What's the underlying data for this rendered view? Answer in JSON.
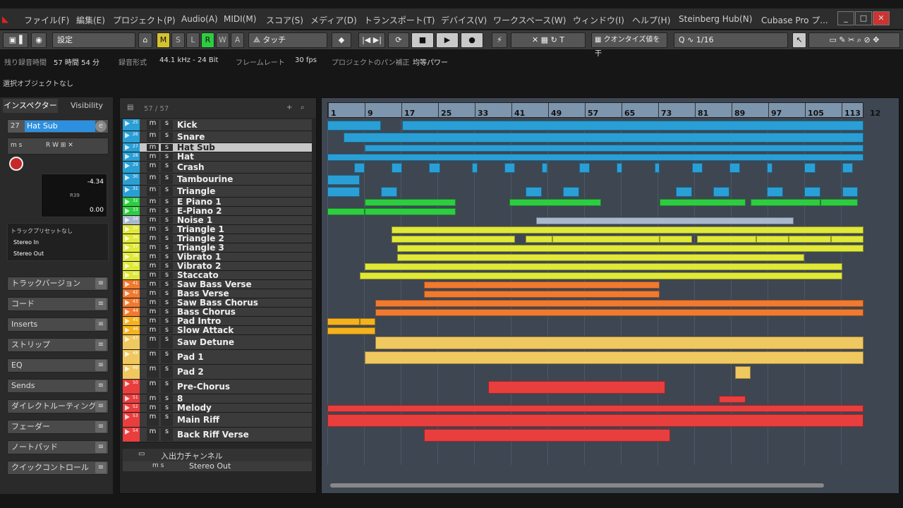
{
  "menu": [
    "ファイル(F)",
    "編集(E)",
    "プロジェクト(P)",
    "Audio(A)",
    "MIDI(M)",
    "スコア(S)",
    "メディア(D)",
    "トランスポート(T)",
    "デバイス(V)",
    "ワークスペース(W)",
    "ウィンドウ(I)",
    "ヘルプ(H)",
    "Steinberg Hub(N)",
    "Cubase Pro プ..."
  ],
  "toolbar": {
    "preset": "設定",
    "modes": [
      "M",
      "S",
      "L",
      "R",
      "W",
      "A"
    ],
    "touch": "タッチ",
    "quantize_label": "クオンタイズ値を干",
    "quantize_value": "1/16"
  },
  "status": {
    "rec_time_label": "残り録音時間",
    "rec_time": "57 時間 54 分",
    "rec_format_label": "録音形式",
    "rec_format": "44.1 kHz - 24 Bit",
    "frame_label": "フレームレート",
    "frame": "30 fps",
    "pan_label": "プロジェクトのパン補正",
    "pan": "均等パワー"
  },
  "info": "選択オブジェクトなし",
  "inspector": {
    "tabs": [
      "インスペクター",
      "Visibility"
    ],
    "track_num": "27",
    "track_name": "Hat Sub",
    "volume": "-4.34",
    "pan": "R39",
    "pan_value": "0.00",
    "preset": "トラックプリセットなし",
    "input": "Stereo In",
    "output": "Stereo Out",
    "sections": [
      "トラックバージョン",
      "コード",
      "Inserts",
      "ストリップ",
      "EQ",
      "Sends",
      "ダイレクトルーティング",
      "フェーダー",
      "ノートパッド",
      "クイックコントロール"
    ]
  },
  "tracklist_header": "57 / 57",
  "tracks": [
    {
      "n": "25",
      "name": "Kick",
      "color": "#2a9fd6",
      "h": 17
    },
    {
      "n": "26",
      "name": "Snare",
      "color": "#2a9fd6",
      "h": 17
    },
    {
      "n": "27",
      "name": "Hat Sub",
      "color": "#2a9fd6",
      "h": 13,
      "sel": true
    },
    {
      "n": "28",
      "name": "Hat",
      "color": "#2a9fd6",
      "h": 13
    },
    {
      "n": "29",
      "name": "Crash",
      "color": "#2a9fd6",
      "h": 17
    },
    {
      "n": "30",
      "name": "Tambourine",
      "color": "#2a9fd6",
      "h": 17
    },
    {
      "n": "31",
      "name": "Triangle",
      "color": "#2a9fd6",
      "h": 17
    },
    {
      "n": "32",
      "name": "E Piano 1",
      "color": "#2ecc40",
      "h": 13
    },
    {
      "n": "33",
      "name": "E-Piano 2",
      "color": "#2ecc40",
      "h": 13
    },
    {
      "n": "34",
      "name": "Noise 1",
      "color": "#a9b8cc",
      "h": 13
    },
    {
      "n": "35",
      "name": "Triangle 1",
      "color": "#e0e838",
      "h": 13
    },
    {
      "n": "36",
      "name": "Triangle 2",
      "color": "#e0e838",
      "h": 13
    },
    {
      "n": "37",
      "name": "Triangle 3",
      "color": "#e0e838",
      "h": 13
    },
    {
      "n": "38",
      "name": "Vibrato 1",
      "color": "#e0e838",
      "h": 13
    },
    {
      "n": "39",
      "name": "Vibrato 2",
      "color": "#e0e838",
      "h": 13
    },
    {
      "n": "40",
      "name": "Staccato",
      "color": "#e0e838",
      "h": 13
    },
    {
      "n": "41",
      "name": "Saw Bass Verse",
      "color": "#f07a30",
      "h": 13
    },
    {
      "n": "42",
      "name": "Bass Verse",
      "color": "#f07a30",
      "h": 13
    },
    {
      "n": "43",
      "name": "Saw Bass Chorus",
      "color": "#f07a30",
      "h": 13
    },
    {
      "n": "44",
      "name": "Bass Chorus",
      "color": "#f07a30",
      "h": 13
    },
    {
      "n": "45",
      "name": "Pad Intro",
      "color": "#f5b21c",
      "h": 13
    },
    {
      "n": "46",
      "name": "Slow Attack",
      "color": "#f5b21c",
      "h": 13
    },
    {
      "n": "47",
      "name": "Saw Detune",
      "color": "#f0c860",
      "h": 21
    },
    {
      "n": "48",
      "name": "Pad 1",
      "color": "#f0c860",
      "h": 21
    },
    {
      "n": "49",
      "name": "Pad 2",
      "color": "#f0c860",
      "h": 21
    },
    {
      "n": "50",
      "name": "Pre-Chorus",
      "color": "#e83e3e",
      "h": 21
    },
    {
      "n": "51",
      "name": "8",
      "color": "#e83e3e",
      "h": 13
    },
    {
      "n": "52",
      "name": "Melody",
      "color": "#e83e3e",
      "h": 13
    },
    {
      "n": "53",
      "name": "Main Riff",
      "color": "#e83e3e",
      "h": 21
    },
    {
      "n": "54",
      "name": "Back Riff Verse",
      "color": "#e83e3e",
      "h": 21
    }
  ],
  "io_channel": "入出力チャンネル",
  "stereo_out": "Stereo Out",
  "ruler": [
    "1",
    "9",
    "17",
    "25",
    "33",
    "41",
    "49",
    "57",
    "65",
    "73",
    "81",
    "89",
    "97",
    "105",
    "113",
    "12"
  ],
  "clips": [
    [
      [
        0,
        10,
        "#2a9fd6"
      ],
      [
        14,
        100,
        "#2a9fd6"
      ]
    ],
    [
      [
        3,
        100,
        "#2a9fd6"
      ]
    ],
    [
      [
        7,
        100,
        "#2a9fd6"
      ]
    ],
    [
      [
        0,
        100,
        "#2a9fd6"
      ]
    ],
    [
      [
        5,
        7,
        "#2a9fd6"
      ],
      [
        12,
        14,
        "#2a9fd6"
      ],
      [
        19,
        21,
        "#2a9fd6"
      ],
      [
        27,
        28,
        "#2a9fd6"
      ],
      [
        33,
        35,
        "#2a9fd6"
      ],
      [
        40,
        41,
        "#2a9fd6"
      ],
      [
        47,
        49,
        "#2a9fd6"
      ],
      [
        54,
        55,
        "#2a9fd6"
      ],
      [
        61,
        62,
        "#2a9fd6"
      ],
      [
        68,
        70,
        "#2a9fd6"
      ],
      [
        75,
        77,
        "#2a9fd6"
      ],
      [
        82,
        83,
        "#2a9fd6"
      ],
      [
        89,
        91,
        "#2a9fd6"
      ],
      [
        96,
        98,
        "#2a9fd6"
      ]
    ],
    [
      [
        0,
        6,
        "#2a9fd6"
      ]
    ],
    [
      [
        0,
        6,
        "#2a9fd6"
      ],
      [
        10,
        13,
        "#2a9fd6"
      ],
      [
        37,
        40,
        "#2a9fd6"
      ],
      [
        44,
        47,
        "#2a9fd6"
      ],
      [
        65,
        68,
        "#2a9fd6"
      ],
      [
        72,
        75,
        "#2a9fd6"
      ],
      [
        82,
        85,
        "#2a9fd6"
      ],
      [
        89,
        92,
        "#2a9fd6"
      ],
      [
        96,
        99,
        "#2a9fd6"
      ]
    ],
    [
      [
        7,
        24,
        "#2ecc40"
      ],
      [
        34,
        51,
        "#2ecc40"
      ],
      [
        62,
        78,
        "#2ecc40"
      ],
      [
        79,
        92,
        "#2ecc40"
      ],
      [
        92,
        99,
        "#2ecc40"
      ]
    ],
    [
      [
        0,
        7,
        "#2ecc40"
      ],
      [
        7,
        24,
        "#2ecc40"
      ]
    ],
    [
      [
        39,
        87,
        "#a9b8cc"
      ]
    ],
    [
      [
        12,
        100,
        "#e0e838"
      ]
    ],
    [
      [
        12,
        35,
        "#e0e838"
      ],
      [
        37,
        42,
        "#e0e838"
      ],
      [
        42,
        62,
        "#e0e838"
      ],
      [
        62,
        68,
        "#e0e838"
      ],
      [
        69,
        80,
        "#e0e838"
      ],
      [
        80,
        86,
        "#e0e838"
      ],
      [
        86,
        94,
        "#e0e838"
      ],
      [
        94,
        100,
        "#e0e838"
      ]
    ],
    [
      [
        13,
        100,
        "#e0e838"
      ]
    ],
    [
      [
        13,
        89,
        "#e0e838"
      ]
    ],
    [
      [
        7,
        96,
        "#e0e838"
      ]
    ],
    [
      [
        6,
        96,
        "#e0e838"
      ]
    ],
    [
      [
        18,
        62,
        "#f07a30"
      ]
    ],
    [
      [
        18,
        62,
        "#f07a30"
      ]
    ],
    [
      [
        9,
        100,
        "#f07a30"
      ]
    ],
    [
      [
        9,
        100,
        "#f07a30"
      ]
    ],
    [
      [
        0,
        6,
        "#f5b21c"
      ],
      [
        6,
        9,
        "#f5b21c"
      ]
    ],
    [
      [
        0,
        9,
        "#f5b21c"
      ]
    ],
    [
      [
        9,
        100,
        "#f0c860"
      ]
    ],
    [
      [
        7,
        100,
        "#f0c860"
      ]
    ],
    [
      [
        76,
        79,
        "#f0c860"
      ]
    ],
    [
      [
        30,
        63,
        "#e83e3e"
      ]
    ],
    [
      [
        73,
        78,
        "#e83e3e"
      ]
    ],
    [
      [
        0,
        100,
        "#e83e3e"
      ]
    ],
    [
      [
        0,
        100,
        "#e83e3e"
      ]
    ],
    [
      [
        18,
        64,
        "#e83e3e"
      ]
    ]
  ]
}
